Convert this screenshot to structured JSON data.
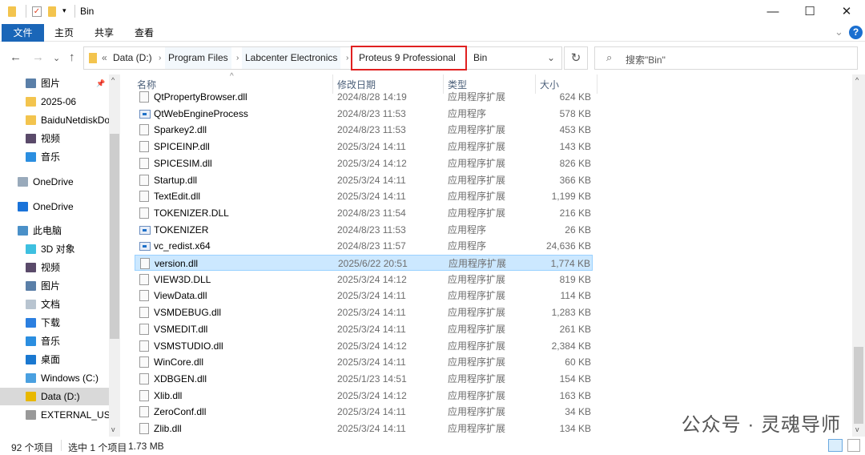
{
  "window": {
    "title": "Bin",
    "minimize": "—",
    "maximize": "☐",
    "close": "✕"
  },
  "ribbon": {
    "tabs": [
      "文件",
      "主页",
      "共享",
      "查看"
    ],
    "help": "?",
    "expand": "⌄"
  },
  "nav": {
    "back": "←",
    "forward": "→",
    "recent": "⌄",
    "up": "↑"
  },
  "address": {
    "overflow": "«",
    "crumbs": [
      "Data (D:)",
      "Program Files",
      "Labcenter Electronics",
      "Proteus 9 Professional",
      "Bin"
    ],
    "highlighted": "Proteus 9 Professional",
    "dropdown": "⌄"
  },
  "search": {
    "placeholder": "搜索\"Bin\""
  },
  "sidebar": {
    "items": [
      {
        "label": "图片",
        "icon": "pictures-icon",
        "pinned": true
      },
      {
        "label": "2025-06",
        "icon": "folder-icon"
      },
      {
        "label": "BaiduNetdiskDownload",
        "icon": "folder-icon"
      },
      {
        "label": "视频",
        "icon": "videos-icon"
      },
      {
        "label": "音乐",
        "icon": "music-icon"
      },
      {
        "label": "OneDrive",
        "icon": "onedrive-app-icon"
      },
      {
        "label": "OneDrive",
        "icon": "onedrive-cloud-icon"
      },
      {
        "label": "此电脑",
        "icon": "this-pc-icon"
      },
      {
        "label": "3D 对象",
        "icon": "3d-objects-icon"
      },
      {
        "label": "视频",
        "icon": "videos-icon"
      },
      {
        "label": "图片",
        "icon": "pictures-icon"
      },
      {
        "label": "文档",
        "icon": "documents-icon"
      },
      {
        "label": "下载",
        "icon": "downloads-icon"
      },
      {
        "label": "音乐",
        "icon": "music-icon"
      },
      {
        "label": "桌面",
        "icon": "desktop-icon"
      },
      {
        "label": "Windows (C:)",
        "icon": "windows-drive-icon"
      },
      {
        "label": "Data (D:)",
        "icon": "drive-warning-icon",
        "selected": true
      },
      {
        "label": "EXTERNAL_USB",
        "icon": "usb-drive-icon"
      }
    ]
  },
  "columns": [
    "名称",
    "修改日期",
    "类型",
    "大小"
  ],
  "files": [
    {
      "name": "QtPropertyBrowser.dll",
      "date": "2024/8/28 14:19",
      "type": "应用程序扩展",
      "size": "624 KB",
      "kind": "dll"
    },
    {
      "name": "QtWebEngineProcess",
      "date": "2024/8/23 11:53",
      "type": "应用程序",
      "size": "578 KB",
      "kind": "exe"
    },
    {
      "name": "Sparkey2.dll",
      "date": "2024/8/23 11:53",
      "type": "应用程序扩展",
      "size": "453 KB",
      "kind": "dll"
    },
    {
      "name": "SPICEINP.dll",
      "date": "2025/3/24 14:11",
      "type": "应用程序扩展",
      "size": "143 KB",
      "kind": "dll"
    },
    {
      "name": "SPICESIM.dll",
      "date": "2025/3/24 14:12",
      "type": "应用程序扩展",
      "size": "826 KB",
      "kind": "dll"
    },
    {
      "name": "Startup.dll",
      "date": "2025/3/24 14:11",
      "type": "应用程序扩展",
      "size": "366 KB",
      "kind": "dll"
    },
    {
      "name": "TextEdit.dll",
      "date": "2025/3/24 14:11",
      "type": "应用程序扩展",
      "size": "1,199 KB",
      "kind": "dll"
    },
    {
      "name": "TOKENIZER.DLL",
      "date": "2024/8/23 11:54",
      "type": "应用程序扩展",
      "size": "216 KB",
      "kind": "dll"
    },
    {
      "name": "TOKENIZER",
      "date": "2024/8/23 11:53",
      "type": "应用程序",
      "size": "26 KB",
      "kind": "exe"
    },
    {
      "name": "vc_redist.x64",
      "date": "2024/8/23 11:57",
      "type": "应用程序",
      "size": "24,636 KB",
      "kind": "installer"
    },
    {
      "name": "version.dll",
      "date": "2025/6/22 20:51",
      "type": "应用程序扩展",
      "size": "1,774 KB",
      "kind": "dll",
      "selected": true
    },
    {
      "name": "VIEW3D.DLL",
      "date": "2025/3/24 14:12",
      "type": "应用程序扩展",
      "size": "819 KB",
      "kind": "dll"
    },
    {
      "name": "ViewData.dll",
      "date": "2025/3/24 14:11",
      "type": "应用程序扩展",
      "size": "114 KB",
      "kind": "dll"
    },
    {
      "name": "VSMDEBUG.dll",
      "date": "2025/3/24 14:11",
      "type": "应用程序扩展",
      "size": "1,283 KB",
      "kind": "dll"
    },
    {
      "name": "VSMEDIT.dll",
      "date": "2025/3/24 14:11",
      "type": "应用程序扩展",
      "size": "261 KB",
      "kind": "dll"
    },
    {
      "name": "VSMSTUDIO.dll",
      "date": "2025/3/24 14:12",
      "type": "应用程序扩展",
      "size": "2,384 KB",
      "kind": "dll"
    },
    {
      "name": "WinCore.dll",
      "date": "2025/3/24 14:11",
      "type": "应用程序扩展",
      "size": "60 KB",
      "kind": "dll"
    },
    {
      "name": "XDBGEN.dll",
      "date": "2025/1/23 14:51",
      "type": "应用程序扩展",
      "size": "154 KB",
      "kind": "dll"
    },
    {
      "name": "Xlib.dll",
      "date": "2025/3/24 14:12",
      "type": "应用程序扩展",
      "size": "163 KB",
      "kind": "dll"
    },
    {
      "name": "ZeroConf.dll",
      "date": "2025/3/24 14:11",
      "type": "应用程序扩展",
      "size": "34 KB",
      "kind": "dll"
    },
    {
      "name": "Zlib.dll",
      "date": "2025/3/24 14:11",
      "type": "应用程序扩展",
      "size": "134 KB",
      "kind": "dll"
    }
  ],
  "status": {
    "count": "92 个项目",
    "selected": "选中 1 个项目",
    "size": "1.73 MB"
  },
  "watermark": "公众号 · 灵魂导师",
  "colors": {
    "accent": "#1a66b8",
    "selection": "#cce8ff",
    "highlight_box": "#e02020"
  }
}
